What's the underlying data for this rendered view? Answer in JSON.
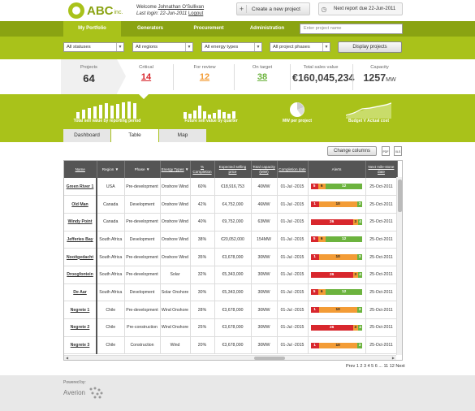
{
  "header": {
    "logo_text": "ABC",
    "logo_suffix": "inc.",
    "welcome_prefix": "Welcome ",
    "user_name": "Johnathan O'Sullivan",
    "last_login_prefix": "Last login: 22-Jun-2011 ",
    "logout": "Logout",
    "new_project": "Create a new project",
    "next_report": "Next report due 22-Jun-2011"
  },
  "nav": {
    "items": [
      "My Portfolio",
      "Generators",
      "Procurement",
      "Administration"
    ],
    "search_placeholder": "Enter project name"
  },
  "filters": {
    "statuses": "All statuses",
    "regions": "All regions",
    "energy": "All energy types",
    "phases": "All project phases",
    "display": "Display projects"
  },
  "stats": [
    {
      "label": "Projects",
      "value": "64",
      "color": "#333333"
    },
    {
      "label": "Critical",
      "value": "14",
      "color": "#d8272d"
    },
    {
      "label": "For review",
      "value": "12",
      "color": "#f39c36"
    },
    {
      "label": "On target",
      "value": "38",
      "color": "#6cb33e"
    },
    {
      "label": "Total sales value",
      "value": "€160,045,234",
      "color": "#444444"
    },
    {
      "label": "Capacity",
      "value": "1257",
      "unit": "MW",
      "color": "#444444"
    }
  ],
  "minis": {
    "total_sell": "Total sell value by reporting period",
    "future_sell": "Future sell value by quarter",
    "mw_project": "MW per project",
    "budget": "Budget V Actual cost"
  },
  "tabs": [
    "Dashboard",
    "Table",
    "Map"
  ],
  "toolbar": {
    "change_columns": "Change columns",
    "pdf": "PDF",
    "xls": "XLS"
  },
  "columns": [
    "Name",
    "Region",
    "Phase",
    "Energy Types",
    "% Completion",
    "Expected selling price",
    "Total capacity (MW)",
    "Completion date",
    "Alerts",
    "Next mile-stone date"
  ],
  "rows": [
    {
      "name": "Green River 1",
      "region": "USA",
      "phase": "Pre-development",
      "energy": "Onshore Wind",
      "pct": "60%",
      "price": "€18,916,753",
      "cap": "40MW",
      "date": "01-Jul -2015",
      "alerts": [
        [
          "r",
          "5"
        ],
        [
          "o",
          "6"
        ],
        [
          "g",
          "12"
        ]
      ],
      "next": "25-Oct-2011"
    },
    {
      "name": "Old Man",
      "region": "Canada",
      "phase": "Development",
      "energy": "Onshore Wind",
      "pct": "42%",
      "price": "€4,752,000",
      "cap": "46MW",
      "date": "01-Jul -2015",
      "alerts": [
        [
          "r",
          "1"
        ],
        [
          "o",
          "10"
        ],
        [
          "g",
          "3"
        ]
      ],
      "next": "25-Oct-2011"
    },
    {
      "name": "Windy Point",
      "region": "Canada",
      "phase": "Pre-development",
      "energy": "Onshore Wind",
      "pct": "40%",
      "price": "€9,752,000",
      "cap": "63MW",
      "date": "01-Jul -2015",
      "alerts": [
        [
          "r",
          "26"
        ],
        [
          "o",
          "3"
        ],
        [
          "g",
          "4"
        ]
      ],
      "next": "25-Oct-2011"
    },
    {
      "name": "Jefferies Bay",
      "region": "South Africa",
      "phase": "Development",
      "energy": "Onshore Wind",
      "pct": "38%",
      "price": "€20,052,000",
      "cap": "154MW",
      "date": "01-Jul -2015",
      "alerts": [
        [
          "r",
          "5"
        ],
        [
          "o",
          "6"
        ],
        [
          "g",
          "12"
        ]
      ],
      "next": "25-Oct-2011"
    },
    {
      "name": "Nooitgedacht",
      "region": "South Africa",
      "phase": "Pre-development",
      "energy": "Onshore Wind",
      "pct": "35%",
      "price": "€3,678,000",
      "cap": "30MW",
      "date": "01-Jul -2015",
      "alerts": [
        [
          "r",
          "1"
        ],
        [
          "o",
          "10"
        ],
        [
          "g",
          "3"
        ]
      ],
      "next": "25-Oct-2011"
    },
    {
      "name": "Droogfontein",
      "region": "South Africa",
      "phase": "Pre-development",
      "energy": "Solar",
      "pct": "32%",
      "price": "€5,343,000",
      "cap": "30MW",
      "date": "01-Jul -2015",
      "alerts": [
        [
          "r",
          "26"
        ],
        [
          "o",
          "3"
        ],
        [
          "g",
          "4"
        ]
      ],
      "next": "25-Oct-2011"
    },
    {
      "name": "De Aar",
      "region": "South Africa",
      "phase": "Development",
      "energy": "Solar Onshore",
      "pct": "30%",
      "price": "€5,343,000",
      "cap": "30MW",
      "date": "01-Jul -2015",
      "alerts": [
        [
          "r",
          "5"
        ],
        [
          "o",
          "6"
        ],
        [
          "g",
          "12"
        ]
      ],
      "next": "25-Oct-2011"
    },
    {
      "name": "Negrete 1",
      "region": "Chile",
      "phase": "Pre-development",
      "energy": "Wind Onshore",
      "pct": "28%",
      "price": "€3,678,000",
      "cap": "30MW",
      "date": "01-Jul -2015",
      "alerts": [
        [
          "r",
          "1"
        ],
        [
          "o",
          "10"
        ],
        [
          "g",
          "3"
        ]
      ],
      "next": "25-Oct-2011"
    },
    {
      "name": "Negrete 2",
      "region": "Chile",
      "phase": "Pre-construction",
      "energy": "Wind Onshore",
      "pct": "25%",
      "price": "€3,678,000",
      "cap": "30MW",
      "date": "01-Jul -2015",
      "alerts": [
        [
          "r",
          "26"
        ],
        [
          "o",
          "3"
        ],
        [
          "g",
          "4"
        ]
      ],
      "next": "25-Oct-2011"
    },
    {
      "name": "Negrete 3",
      "region": "Chile",
      "phase": "Construction",
      "energy": "Wind",
      "pct": "20%",
      "price": "€3,678,000",
      "cap": "30MW",
      "date": "01-Jul -2015",
      "alerts": [
        [
          "r",
          "1"
        ],
        [
          "o",
          "10"
        ],
        [
          "g",
          "3"
        ]
      ],
      "next": "25-Oct-2011"
    }
  ],
  "pager": "Prev 1 2 3 4 5 6 ... 11 12 Next",
  "footer": {
    "powered": "Powered by:",
    "brand": "Averion"
  }
}
